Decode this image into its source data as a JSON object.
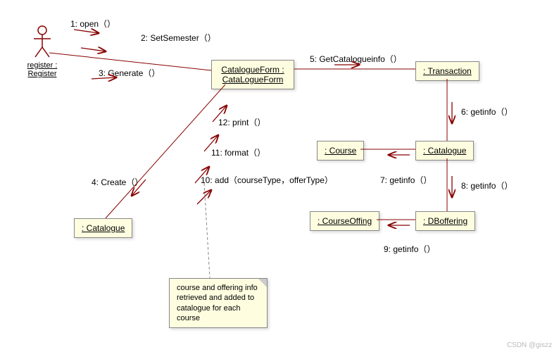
{
  "actor": {
    "name": "register :",
    "class": "Register"
  },
  "objects": {
    "catalogueForm": "CatalogueForm :\nCataLogueForm",
    "transaction": ": Transaction",
    "course": ": Course",
    "catalogue1": ": Catalogue",
    "catalogue2": ": Catalogue",
    "courseOffing": ": CourseOffing",
    "dboffering": ": DBoffering"
  },
  "messages": {
    "m1": "1: open（）",
    "m2": "2: SetSemester（）",
    "m3": "3: Generate（）",
    "m4": "4: Create（）",
    "m5": "5: GetCatalogueinfo（）",
    "m6": "6: getinfo（）",
    "m7": "7: getinfo（）",
    "m8": "8: getinfo（）",
    "m9": "9: getinfo（）",
    "m10": "10: add（courseType，offerType）",
    "m11": "11: format（）",
    "m12": "12: print（）"
  },
  "note": "course and offering info retrieved and added to catalogue for each course",
  "watermark": "CSDN @giszz",
  "chart_data": {
    "type": "uml-collaboration",
    "actors": [
      {
        "name": "register",
        "class": "Register"
      }
    ],
    "objects": [
      {
        "id": "catalogueForm",
        "class": "CataLogueForm",
        "label": "CatalogueForm"
      },
      {
        "id": "transaction",
        "class": "Transaction"
      },
      {
        "id": "catalogue1",
        "class": "Catalogue"
      },
      {
        "id": "catalogue2",
        "class": "Catalogue"
      },
      {
        "id": "course",
        "class": "Course"
      },
      {
        "id": "dboffering",
        "class": "DBoffering"
      },
      {
        "id": "courseOffing",
        "class": "CourseOffing"
      }
    ],
    "messages": [
      {
        "seq": 1,
        "from": "register",
        "to": "catalogueForm",
        "name": "open()"
      },
      {
        "seq": 2,
        "from": "register",
        "to": "catalogueForm",
        "name": "SetSemester()"
      },
      {
        "seq": 3,
        "from": "register",
        "to": "catalogueForm",
        "name": "Generate()"
      },
      {
        "seq": 4,
        "from": "catalogueForm",
        "to": "catalogue2",
        "name": "Create()"
      },
      {
        "seq": 5,
        "from": "catalogueForm",
        "to": "transaction",
        "name": "GetCatalogueinfo()"
      },
      {
        "seq": 6,
        "from": "transaction",
        "to": "catalogue1",
        "name": "getinfo()"
      },
      {
        "seq": 7,
        "from": "catalogue1",
        "to": "course",
        "name": "getinfo()"
      },
      {
        "seq": 8,
        "from": "catalogue1",
        "to": "dboffering",
        "name": "getinfo()"
      },
      {
        "seq": 9,
        "from": "dboffering",
        "to": "courseOffing",
        "name": "getinfo()"
      },
      {
        "seq": 10,
        "from": "catalogue2",
        "to": "catalogueForm",
        "name": "add(courseType, offerType)"
      },
      {
        "seq": 11,
        "from": "catalogue2",
        "to": "catalogueForm",
        "name": "format()"
      },
      {
        "seq": 12,
        "from": "catalogue2",
        "to": "catalogueForm",
        "name": "print()"
      }
    ],
    "notes": [
      {
        "text": "course and offering info retrieved and added to catalogue for each course",
        "attachedTo": "m10"
      }
    ]
  }
}
